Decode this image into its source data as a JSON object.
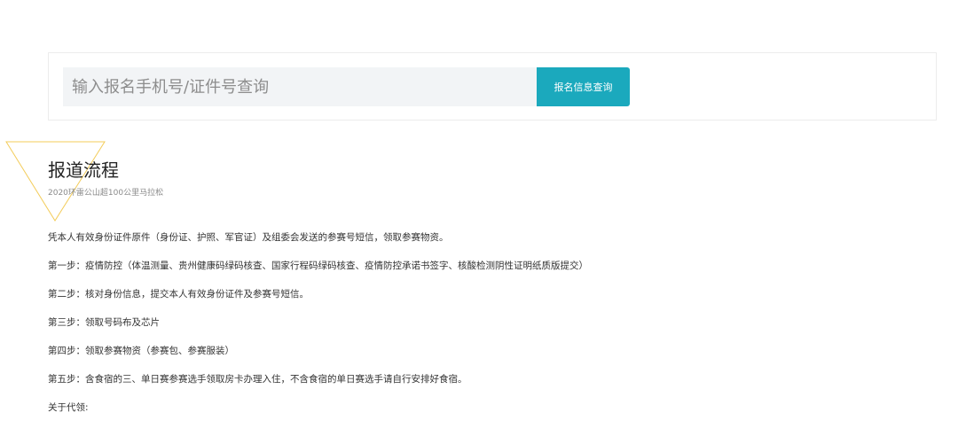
{
  "search": {
    "placeholder": "输入报名手机号/证件号查询",
    "button_label": "报名信息查询",
    "button_color": "#1ba9bd"
  },
  "section": {
    "title": "报道流程",
    "subtitle": "2020环雷公山超100公里马拉松",
    "accent_color": "#f3cc5a"
  },
  "steps": [
    "凭本人有效身份证件原件（身份证、护照、军官证）及组委会发送的参赛号短信，领取参赛物资。",
    "第一步：疫情防控（体温测量、贵州健康码绿码核查、国家行程码绿码核查、疫情防控承诺书签字、核酸检测阴性证明纸质版提交）",
    "第二步：核对身份信息，提交本人有效身份证件及参赛号短信。",
    "第三步：领取号码布及芯片",
    "第四步：领取参赛物资（参赛包、参赛服装）",
    "第五步：含食宿的三、单日赛参赛选手领取房卡办理入住，不含食宿的单日赛选手请自行安排好食宿。",
    "关于代领:"
  ]
}
